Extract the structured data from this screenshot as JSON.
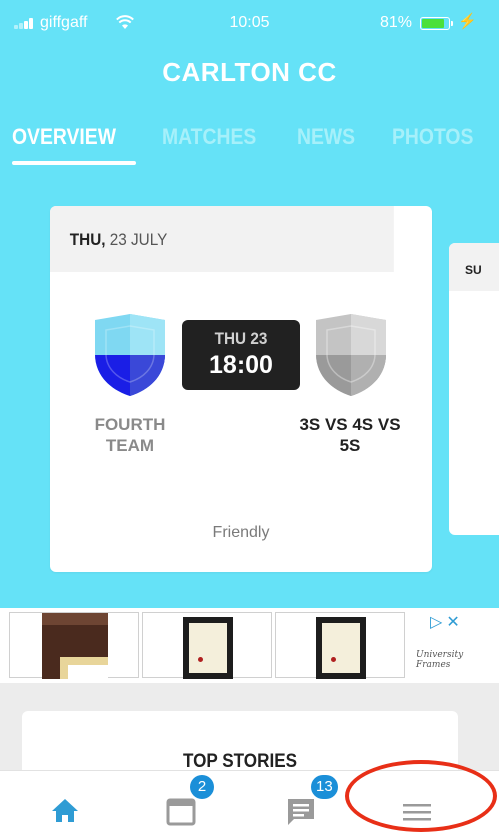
{
  "status_bar": {
    "carrier": "giffgaff",
    "time": "10:05",
    "battery_percent": "81%",
    "battery_level": 0.81
  },
  "header": {
    "club_name": "CARLTON CC"
  },
  "tabs": [
    {
      "label": "OVERVIEW",
      "active": true
    },
    {
      "label": "MATCHES",
      "active": false
    },
    {
      "label": "NEWS",
      "active": false
    },
    {
      "label": "PHOTOS",
      "active": false
    }
  ],
  "match_card": {
    "date_day": "THU,",
    "date_rest": " 23 JULY",
    "kickoff_date": "THU 23",
    "kickoff_time": "18:00",
    "home_team": "FOURTH TEAM",
    "away_team": "3S VS 4S VS 5S",
    "match_type": "Friendly"
  },
  "next_card_peek": {
    "header_text": "SU"
  },
  "ad": {
    "brand": "University Frames"
  },
  "top_stories": {
    "title": "TOP STORIES"
  },
  "bottom_nav": {
    "items": [
      {
        "icon": "home-icon",
        "badge": ""
      },
      {
        "icon": "calendar-icon",
        "badge": "2"
      },
      {
        "icon": "chat-icon",
        "badge": "13"
      },
      {
        "icon": "menu-icon",
        "badge": ""
      }
    ]
  },
  "colors": {
    "hero_bg": "#65e2f7",
    "accent": "#2f9cd4",
    "badge": "#1b8fd8",
    "highlight": "#e82f17"
  }
}
